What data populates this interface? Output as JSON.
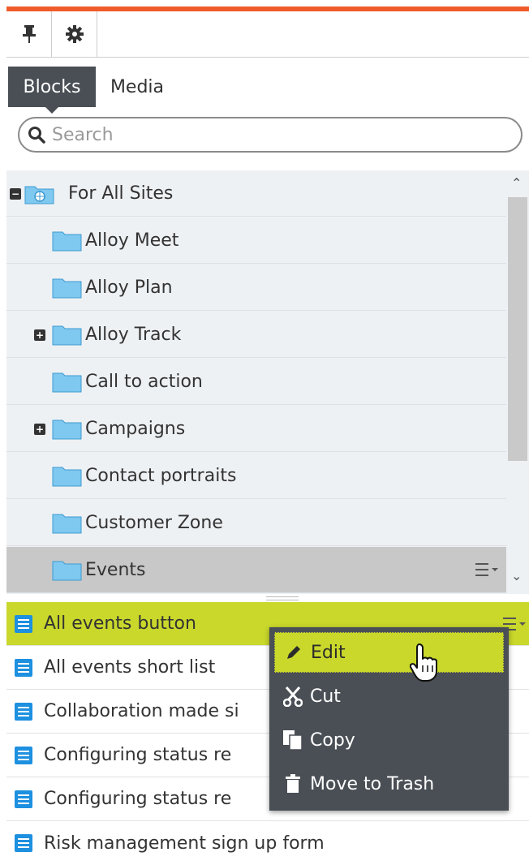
{
  "toolbar": {
    "pin_icon": "pin-icon",
    "settings_icon": "gear-icon",
    "accent_color": "#f05b2b"
  },
  "tabs": [
    {
      "label": "Blocks",
      "active": true
    },
    {
      "label": "Media",
      "active": false
    }
  ],
  "search": {
    "placeholder": "Search",
    "value": ""
  },
  "tree": {
    "root": {
      "label": "For All Sites",
      "expanded": true
    },
    "items": [
      {
        "label": "Alloy Meet",
        "expandable": false
      },
      {
        "label": "Alloy Plan",
        "expandable": false
      },
      {
        "label": "Alloy Track",
        "expandable": true
      },
      {
        "label": "Call to action",
        "expandable": false
      },
      {
        "label": "Campaigns",
        "expandable": true
      },
      {
        "label": "Contact portraits",
        "expandable": false
      },
      {
        "label": "Customer Zone",
        "expandable": false
      },
      {
        "label": "Events",
        "expandable": false,
        "selected": true
      }
    ]
  },
  "list": {
    "items": [
      {
        "label": "All events button",
        "highlighted": true
      },
      {
        "label": "All events short list"
      },
      {
        "label": "Collaboration made si"
      },
      {
        "label": "Configuring status re"
      },
      {
        "label": "Configuring status re"
      },
      {
        "label": "Risk management sign up form"
      }
    ]
  },
  "context_menu": {
    "items": [
      {
        "label": "Edit",
        "icon": "pencil-icon",
        "hover": true
      },
      {
        "label": "Cut",
        "icon": "scissors-icon"
      },
      {
        "label": "Copy",
        "icon": "copy-icon"
      },
      {
        "label": "Move to Trash",
        "icon": "trash-icon"
      }
    ]
  },
  "colors": {
    "selection_green": "#c9d82b",
    "block_icon_blue": "#1e90e0",
    "folder_blue": "#7fc8f0",
    "menu_bg": "#4a4f55"
  }
}
